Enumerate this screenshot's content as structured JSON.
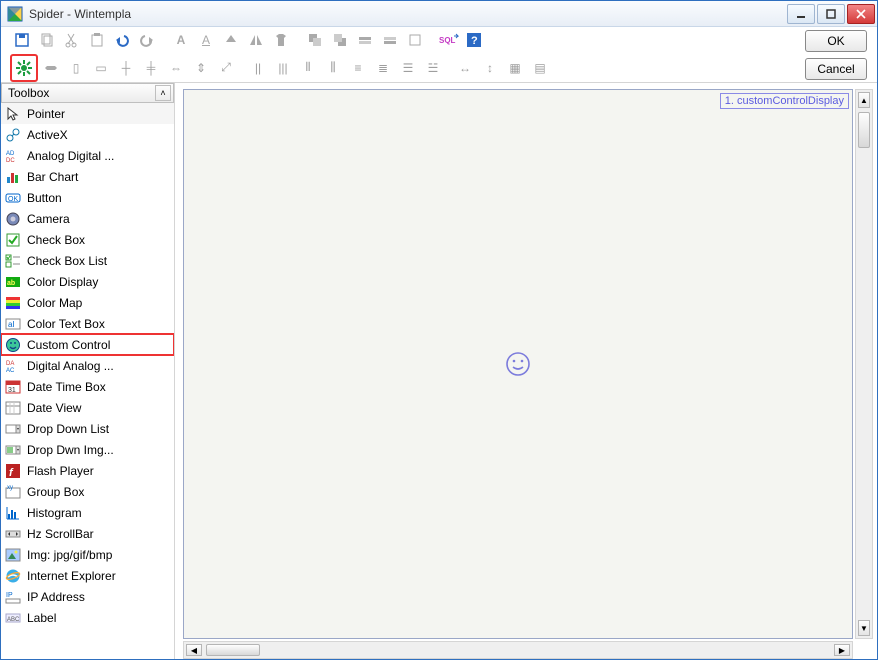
{
  "window": {
    "title": "Spider   -   Wintempla"
  },
  "buttons": {
    "ok": "OK",
    "cancel": "Cancel"
  },
  "toolbox": {
    "header": "Toolbox",
    "items": [
      {
        "label": "Pointer",
        "icon": "pointer"
      },
      {
        "label": "ActiveX",
        "icon": "activex"
      },
      {
        "label": "Analog Digital ...",
        "icon": "adc"
      },
      {
        "label": "Bar Chart",
        "icon": "barchart"
      },
      {
        "label": "Button",
        "icon": "button"
      },
      {
        "label": "Camera",
        "icon": "camera"
      },
      {
        "label": "Check Box",
        "icon": "checkbox"
      },
      {
        "label": "Check Box List",
        "icon": "checkboxlist"
      },
      {
        "label": "Color Display",
        "icon": "colordisplay"
      },
      {
        "label": "Color Map",
        "icon": "colormap"
      },
      {
        "label": "Color Text Box",
        "icon": "colortextbox"
      },
      {
        "label": "Custom Control",
        "icon": "customcontrol"
      },
      {
        "label": "Digital Analog ...",
        "icon": "dac"
      },
      {
        "label": "Date Time Box",
        "icon": "datetimebox"
      },
      {
        "label": "Date View",
        "icon": "dateview"
      },
      {
        "label": "Drop Down List",
        "icon": "dropdownlist"
      },
      {
        "label": "Drop Dwn Img...",
        "icon": "dropdownimg"
      },
      {
        "label": "Flash Player",
        "icon": "flashplayer"
      },
      {
        "label": "Group Box",
        "icon": "groupbox"
      },
      {
        "label": "Histogram",
        "icon": "histogram"
      },
      {
        "label": "Hz ScrollBar",
        "icon": "hzscrollbar"
      },
      {
        "label": "Img: jpg/gif/bmp",
        "icon": "img"
      },
      {
        "label": "Internet Explorer",
        "icon": "ie"
      },
      {
        "label": "IP Address",
        "icon": "ipaddress"
      },
      {
        "label": "Label",
        "icon": "label"
      }
    ],
    "selected_index": 0,
    "highlighted_index": 11
  },
  "canvas": {
    "placed_label": "1. customControlDisplay"
  }
}
